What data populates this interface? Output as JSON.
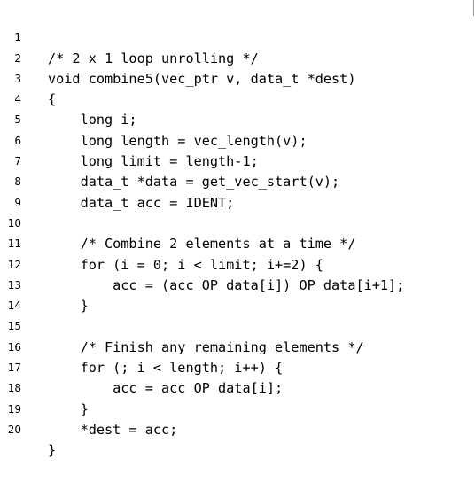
{
  "listing": {
    "lines": [
      {
        "number": "1",
        "code": "/* 2 x 1 loop unrolling */"
      },
      {
        "number": "2",
        "code": "void combine5(vec_ptr v, data_t *dest)"
      },
      {
        "number": "3",
        "code": "{"
      },
      {
        "number": "4",
        "code": "    long i;"
      },
      {
        "number": "5",
        "code": "    long length = vec_length(v);"
      },
      {
        "number": "6",
        "code": "    long limit = length-1;"
      },
      {
        "number": "7",
        "code": "    data_t *data = get_vec_start(v);"
      },
      {
        "number": "8",
        "code": "    data_t acc = IDENT;"
      },
      {
        "number": "9",
        "code": ""
      },
      {
        "number": "10",
        "code": "    /* Combine 2 elements at a time */"
      },
      {
        "number": "11",
        "code": "    for (i = 0; i < limit; i+=2) {"
      },
      {
        "number": "12",
        "code": "        acc = (acc OP data[i]) OP data[i+1];"
      },
      {
        "number": "13",
        "code": "    }"
      },
      {
        "number": "14",
        "code": ""
      },
      {
        "number": "15",
        "code": "    /* Finish any remaining elements */"
      },
      {
        "number": "16",
        "code": "    for (; i < length; i++) {"
      },
      {
        "number": "17",
        "code": "        acc = acc OP data[i];"
      },
      {
        "number": "18",
        "code": "    }"
      },
      {
        "number": "19",
        "code": "    *dest = acc;"
      },
      {
        "number": "20",
        "code": "}"
      }
    ]
  }
}
